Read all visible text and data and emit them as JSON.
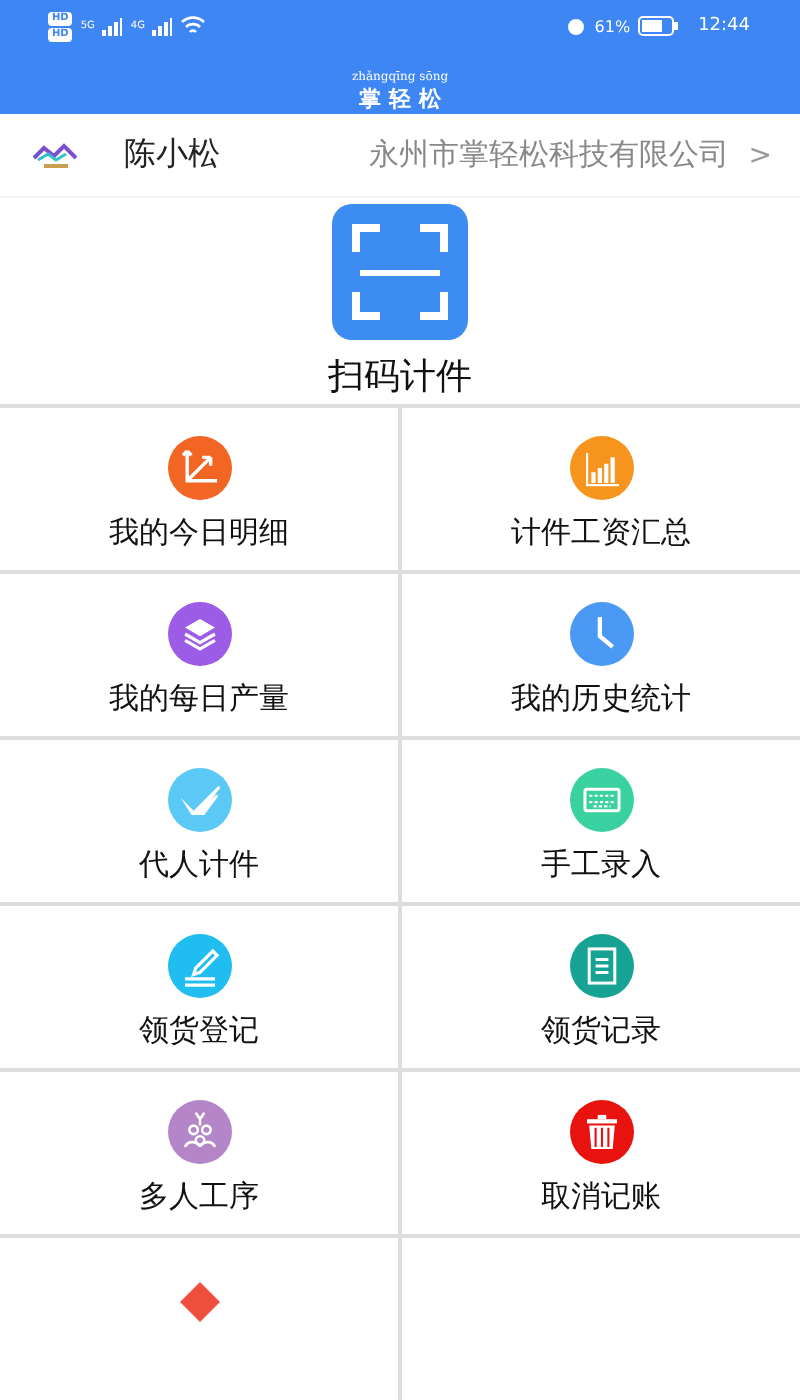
{
  "status_bar": {
    "hd_badges": [
      "HD",
      "HD"
    ],
    "networks": [
      "5G",
      "4G"
    ],
    "battery": "61%",
    "time": "12:44"
  },
  "header": {
    "pinyin": "zhǎngqīng sōng",
    "title": "掌 轻 松"
  },
  "user": {
    "name": "陈小松",
    "company": "永州市掌轻松科技有限公司",
    "chevron": ">"
  },
  "scan": {
    "label": "扫码计件"
  },
  "menu": [
    {
      "label": "我的今日明细",
      "color": "#f26522"
    },
    {
      "label": "计件工资汇总",
      "color": "#f7941d"
    },
    {
      "label": "我的每日产量",
      "color": "#9c5ce6"
    },
    {
      "label": "我的历史统计",
      "color": "#4a9af5"
    },
    {
      "label": "代人计件",
      "color": "#5bc8f5"
    },
    {
      "label": "手工录入",
      "color": "#3ad1a1"
    },
    {
      "label": "领货登记",
      "color": "#1fbdf0"
    },
    {
      "label": "领货记录",
      "color": "#16a394"
    },
    {
      "label": "多人工序",
      "color": "#b486c8"
    },
    {
      "label": "取消记账",
      "color": "#e8130f"
    },
    {
      "color": "#ee4f3c"
    }
  ]
}
